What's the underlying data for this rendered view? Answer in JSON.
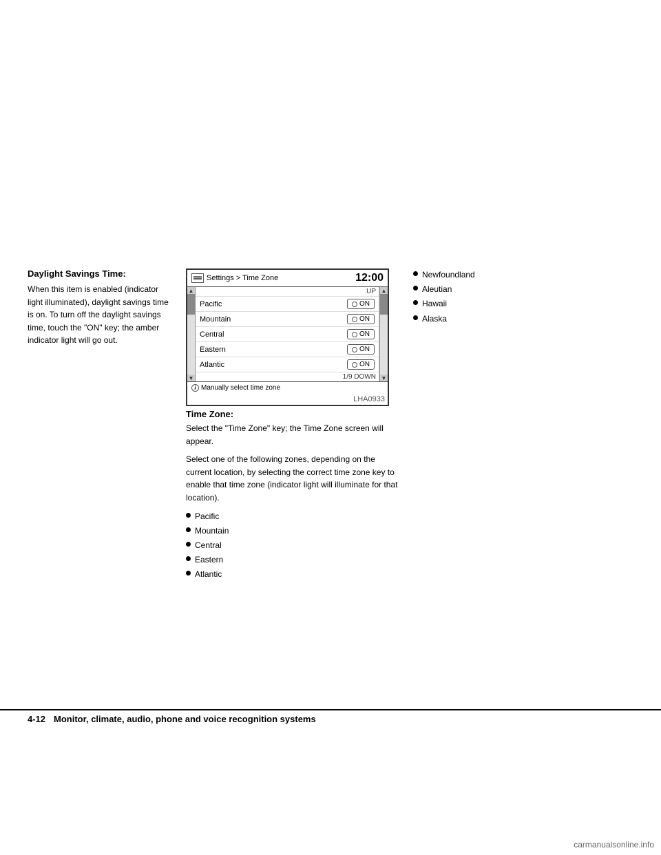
{
  "page": {
    "footer_page": "4-12",
    "footer_title": "Monitor, climate, audio, phone and voice recognition systems",
    "watermark": "carmanualsonline.info"
  },
  "left_col": {
    "section_title": "Daylight Savings Time:",
    "section_body": "When this item is enabled (indicator light illuminated), daylight savings time is on. To turn off the daylight savings time, touch the \"ON\" key; the amber indicator light will go out."
  },
  "screen": {
    "title": "Settings > Time Zone",
    "time": "12:00",
    "up_label": "UP",
    "down_label": "1/9  DOWN",
    "footer_text": "Manually select time zone",
    "lha_code": "LHA0933",
    "rows": [
      {
        "label": "Pacific",
        "button": "ON"
      },
      {
        "label": "Mountain",
        "button": "ON"
      },
      {
        "label": "Central",
        "button": "ON"
      },
      {
        "label": "Eastern",
        "button": "ON"
      },
      {
        "label": "Atlantic",
        "button": "ON"
      }
    ]
  },
  "center_col": {
    "time_zone_title": "Time Zone:",
    "para1": "Select the \"Time Zone\" key; the Time Zone screen will appear.",
    "para2": "Select one of the following zones, depending on the current location, by selecting the correct time zone key to enable that time zone (indicator light will illuminate for that location).",
    "bullets": [
      "Pacific",
      "Mountain",
      "Central",
      "Eastern",
      "Atlantic"
    ]
  },
  "right_col": {
    "bullets": [
      "Newfoundland",
      "Aleutian",
      "Hawaii",
      "Alaska"
    ]
  }
}
